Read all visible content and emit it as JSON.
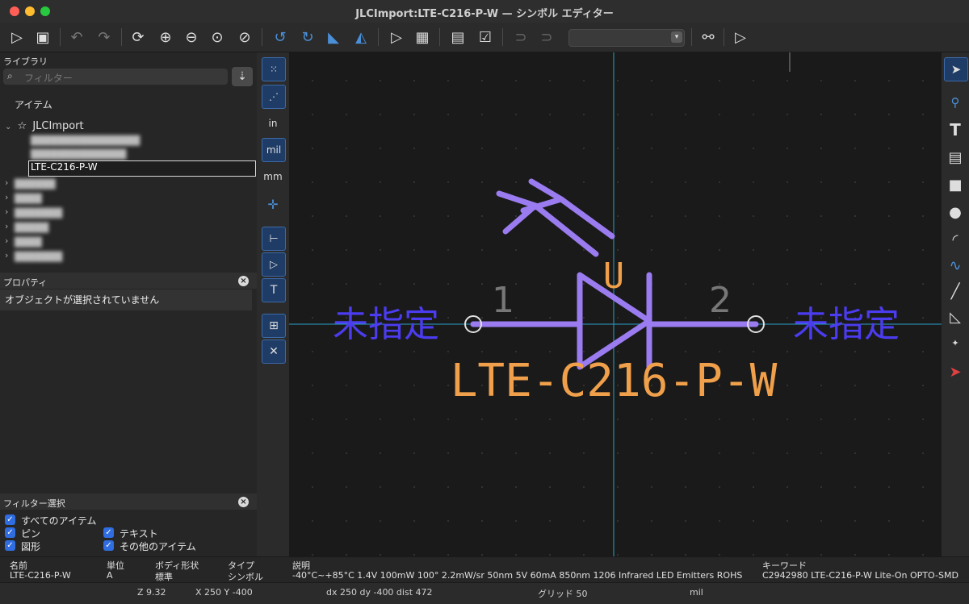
{
  "window": {
    "title": "JLCImport:LTE-C216-P-W — シンボル エディター"
  },
  "library": {
    "header": "ライブラリ",
    "filter_placeholder": "フィルター",
    "items_header": "アイテム",
    "root": "JLCImport",
    "selected_item": "LTE-C216-P-W"
  },
  "properties": {
    "header": "プロパティ",
    "message": "オブジェクトが選択されていません"
  },
  "filter_select": {
    "header": "フィルター選択",
    "all_items": "すべてのアイテム",
    "pins": "ピン",
    "text": "テキスト",
    "graphics": "図形",
    "other_items": "その他のアイテム"
  },
  "units": {
    "in": "in",
    "mil": "mil",
    "mm": "mm"
  },
  "symbol": {
    "reference": "U",
    "value": "LTE-C216-P-W",
    "pin1": "1",
    "pin2": "2",
    "pin_text_left": "未指定",
    "pin_text_right": "未指定"
  },
  "info": {
    "name_label": "名前",
    "name_value": "LTE-C216-P-W",
    "unit_label": "単位",
    "unit_value": "A",
    "body_label": "ボディ形状",
    "body_value": "標準",
    "type_label": "タイプ",
    "type_value": "シンボル",
    "desc_label": "説明",
    "desc_value": "-40°C~+85°C 1.4V 100mW 100° 2.2mW/sr 50nm 5V 60mA 850nm 1206 Infrared LED Emitters ROHS",
    "keyword_label": "キーワード",
    "keyword_value": "C2942980 LTE-C216-P-W Lite-On OPTO-SMD"
  },
  "status": {
    "zoom": "Z 9.32",
    "xy": "X 250  Y -400",
    "delta": "dx 250  dy -400  dist 472",
    "grid": "グリッド 50",
    "units": "mil"
  },
  "colors": {
    "accent": "#3d6aa8",
    "body": "#9a7cf0",
    "pin_text": "#4b3cf0",
    "value_text": "#f0a04a",
    "crosshair": "#2aa0c8"
  }
}
